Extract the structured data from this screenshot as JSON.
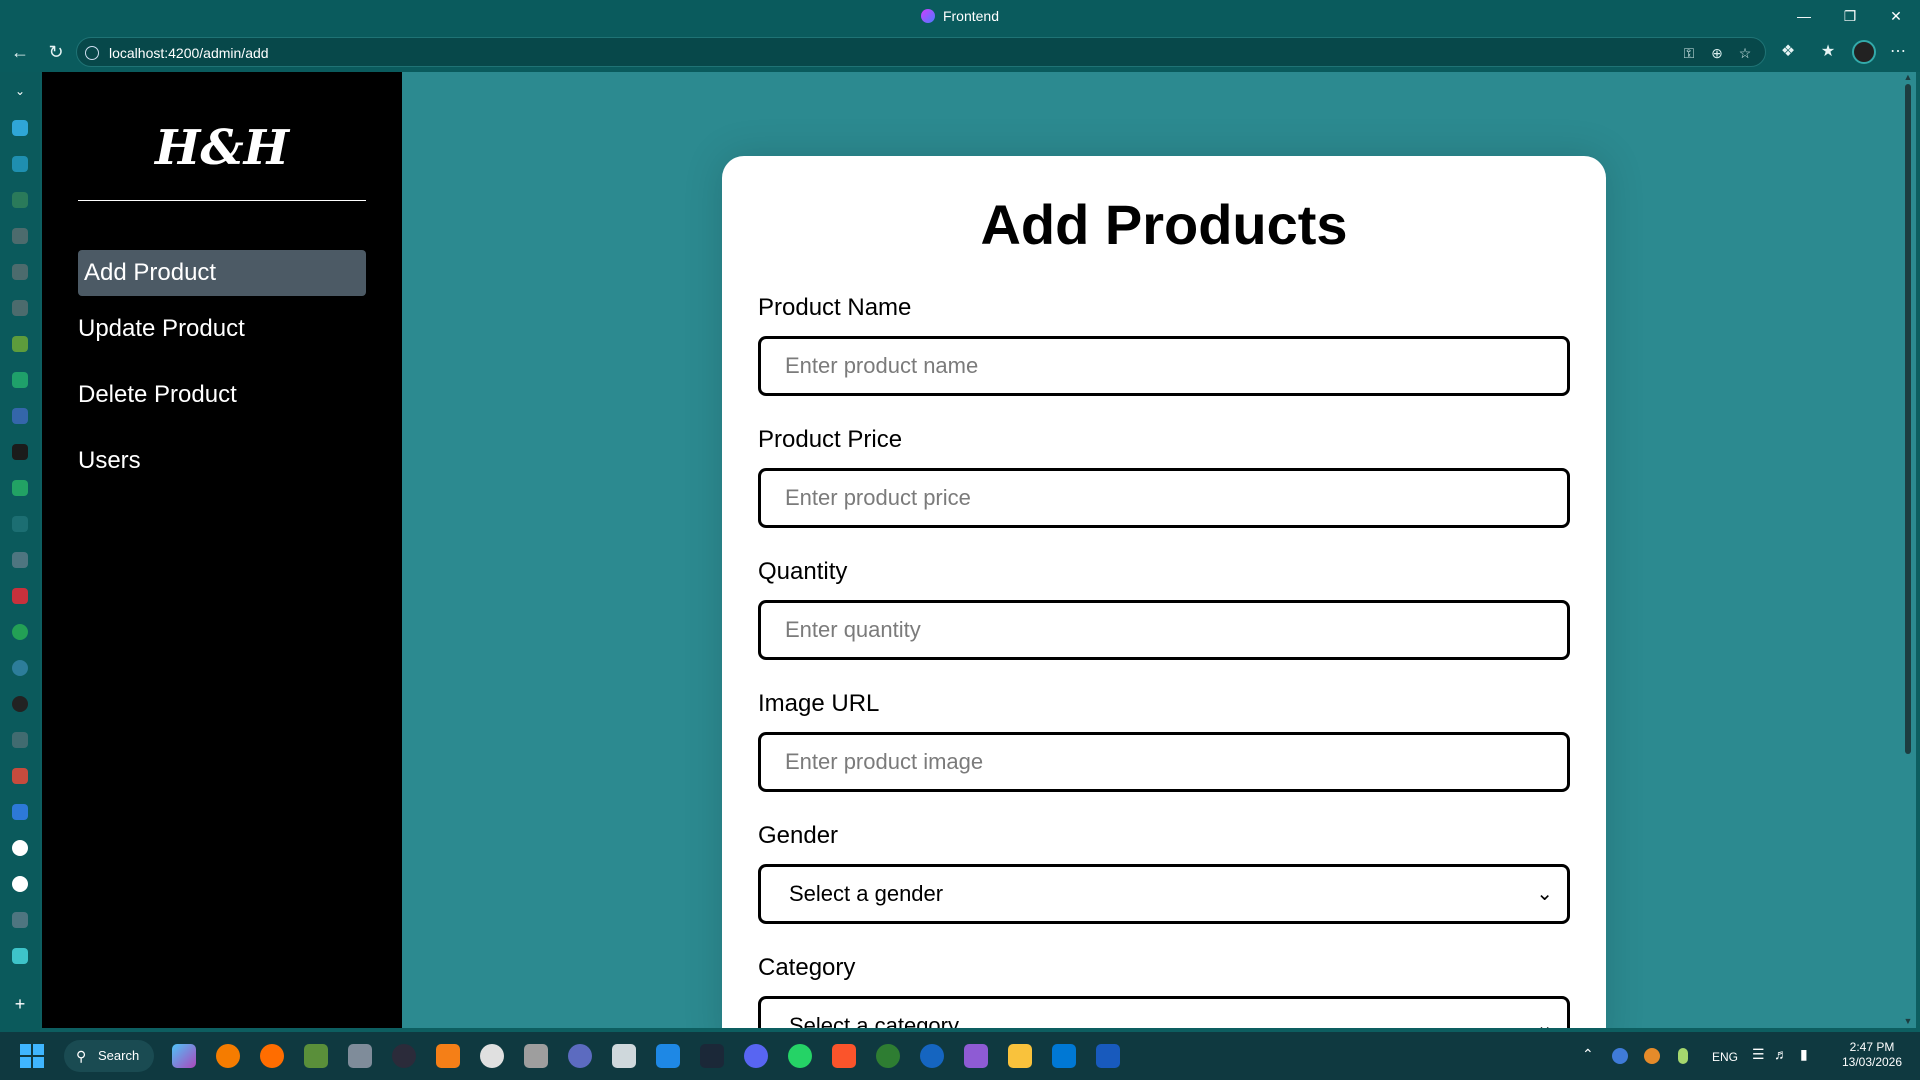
{
  "browser": {
    "window_title": "Frontend",
    "url": "localhost:4200/admin/add"
  },
  "sidebar": {
    "brand": "H&H",
    "items": [
      {
        "label": "Add Product",
        "active": true
      },
      {
        "label": "Update Product",
        "active": false
      },
      {
        "label": "Delete Product",
        "active": false
      },
      {
        "label": "Users",
        "active": false
      }
    ]
  },
  "form": {
    "title": "Add Products",
    "fields": [
      {
        "label": "Product Name",
        "placeholder": "Enter product name",
        "value": ""
      },
      {
        "label": "Product Price",
        "placeholder": "Enter product price",
        "value": ""
      },
      {
        "label": "Quantity",
        "placeholder": "Enter quantity",
        "value": ""
      },
      {
        "label": "Image URL",
        "placeholder": "Enter product image",
        "value": ""
      }
    ],
    "gender": {
      "label": "Gender",
      "selected": "Select a gender"
    },
    "category": {
      "label": "Category",
      "selected": "Select a category"
    }
  },
  "taskbar": {
    "search_label": "Search",
    "language": "ENG",
    "time": "2:47 PM",
    "date": "13/03/2026"
  },
  "colors": {
    "page_background": "#2c8a90",
    "sidebar_background": "#000000",
    "active_item": "#4c5a65",
    "chrome": "#0a5b5d"
  }
}
